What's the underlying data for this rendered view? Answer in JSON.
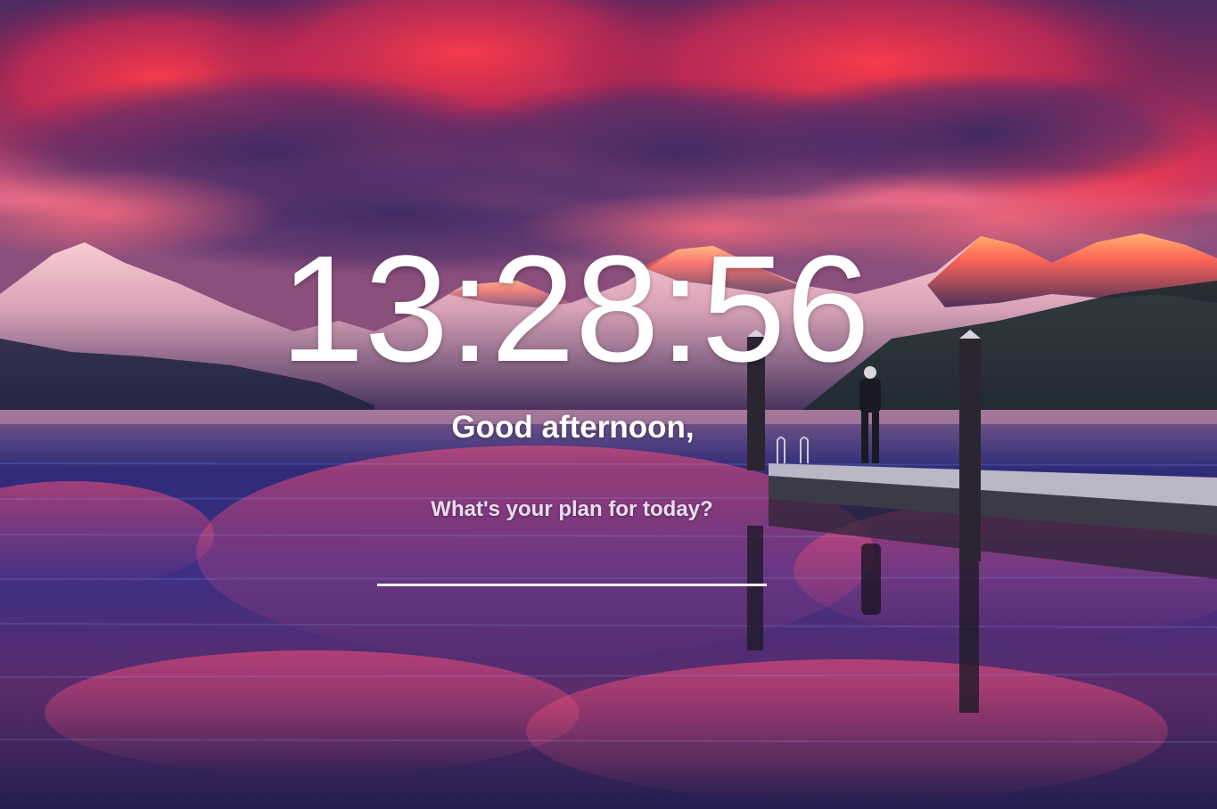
{
  "clock": {
    "time": "13:28:56"
  },
  "greeting": {
    "text": "Good afternoon,"
  },
  "focus": {
    "prompt": "What's your plan for today?",
    "input_value": ""
  },
  "background": {
    "scene": "mountain-lake-sunset-with-pier"
  }
}
